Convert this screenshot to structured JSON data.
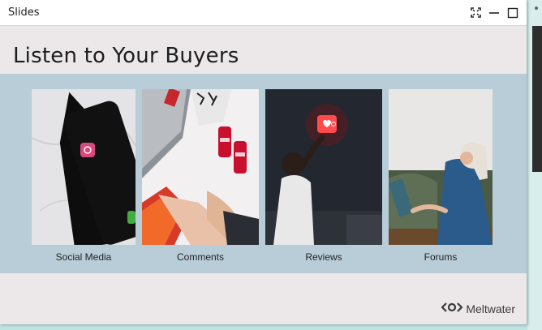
{
  "window": {
    "title": "Slides"
  },
  "slide": {
    "heading": "Listen to Your Buyers",
    "cards": [
      {
        "label": "Social Media"
      },
      {
        "label": "Comments"
      },
      {
        "label": "Reviews"
      },
      {
        "label": "Forums"
      }
    ],
    "brand": "Meltwater"
  },
  "colors": {
    "slide_background": "#ece8ea",
    "band": "#b9cdd8",
    "desktop": "#bfe3e0"
  }
}
